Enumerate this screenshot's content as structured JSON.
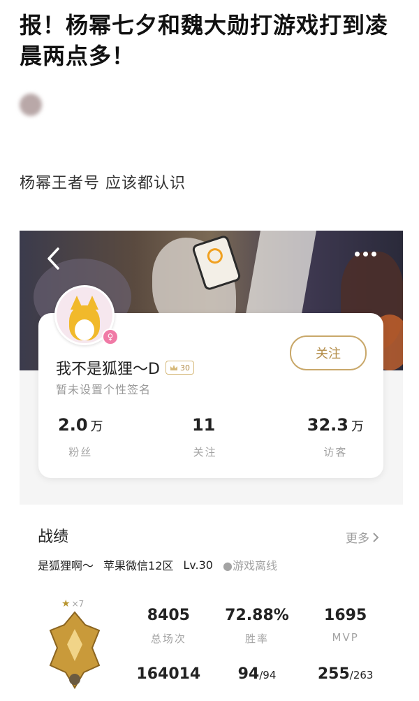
{
  "article": {
    "headline": "报！杨幂七夕和魏大勋打游戏打到凌晨两点多！",
    "caption": "杨幂王者号 应该都认识"
  },
  "profile": {
    "back_icon": "chevron-left-icon",
    "more_icon": "more-dots-icon",
    "nickname": "我不是狐狸～D",
    "level": "30",
    "signature": "暂未设置个性签名",
    "follow_label": "关注",
    "stats": [
      {
        "value": "2.0",
        "unit": "万",
        "label": "粉丝"
      },
      {
        "value": "11",
        "unit": "",
        "label": "关注"
      },
      {
        "value": "32.3",
        "unit": "万",
        "label": "访客"
      }
    ]
  },
  "record": {
    "title": "战绩",
    "more_label": "更多",
    "role_name": "是狐狸啊～",
    "server": "苹果微信12区",
    "level": "Lv.30",
    "status": "●游戏离线",
    "star_count": "×7",
    "stats": [
      {
        "value": "8405",
        "sub": "",
        "label": "总场次"
      },
      {
        "value": "72.88%",
        "sub": "",
        "label": "胜率"
      },
      {
        "value": "1695",
        "sub": "",
        "label": "MVP"
      },
      {
        "value": "164014",
        "sub": "",
        "label": ""
      },
      {
        "value": "94",
        "sub": "/94",
        "label": ""
      },
      {
        "value": "255",
        "sub": "/263",
        "label": ""
      }
    ]
  }
}
